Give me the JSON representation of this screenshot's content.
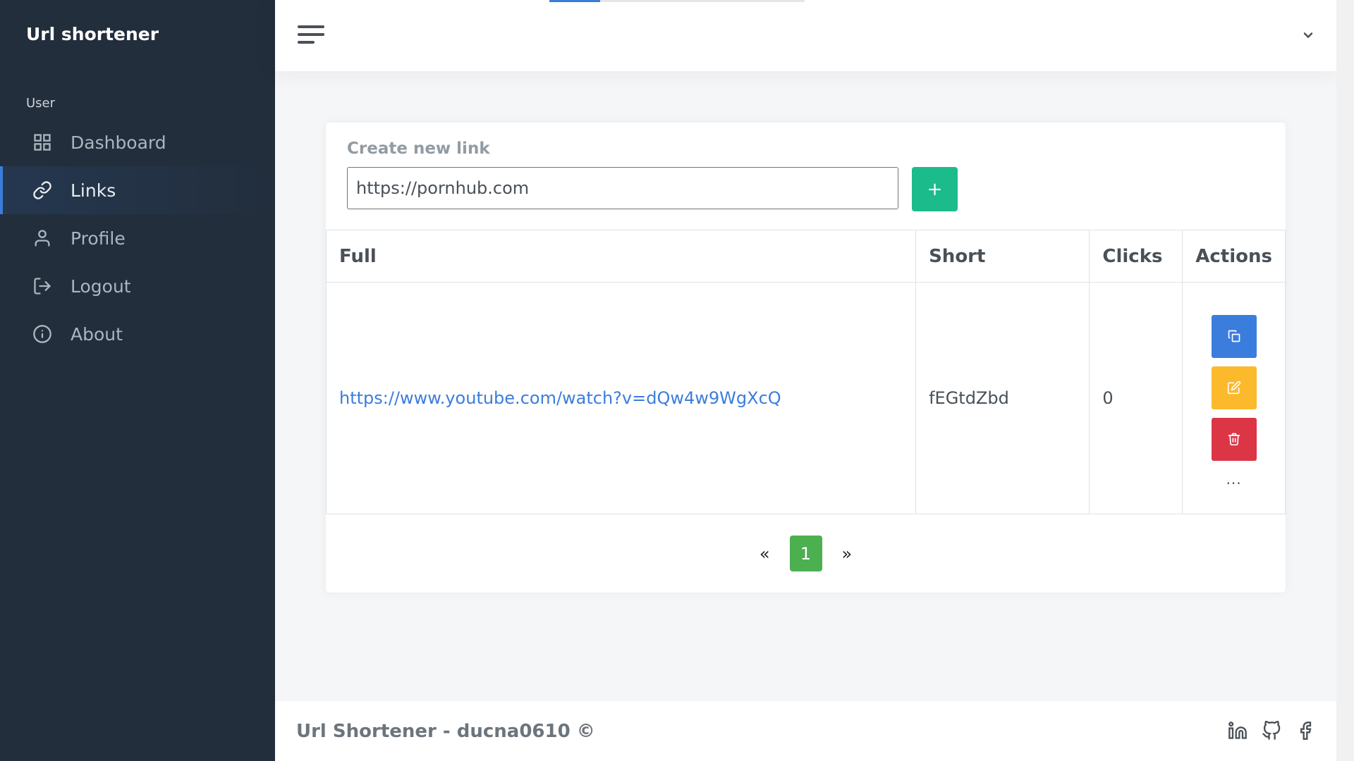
{
  "sidebar": {
    "brand": "Url shortener",
    "section": "User",
    "items": [
      {
        "label": "Dashboard",
        "icon": "grid-icon",
        "active": false
      },
      {
        "label": "Links",
        "icon": "link-icon",
        "active": true
      },
      {
        "label": "Profile",
        "icon": "user-icon",
        "active": false
      },
      {
        "label": "Logout",
        "icon": "logout-icon",
        "active": false
      },
      {
        "label": "About",
        "icon": "info-icon",
        "active": false
      }
    ]
  },
  "topbar": {
    "menu_icon": "hamburger-icon",
    "dropdown_icon": "chevron-down-icon"
  },
  "create": {
    "title": "Create new link",
    "value": "https://pornhub.com",
    "add_label": "+"
  },
  "table": {
    "headers": [
      "Full",
      "Short",
      "Clicks",
      "Actions"
    ],
    "rows": [
      {
        "full": "https://www.youtube.com/watch?v=dQw4w9WgXcQ",
        "short": "fEGtdZbd",
        "clicks": "0"
      }
    ],
    "more_label": "..."
  },
  "pagination": {
    "prev": "«",
    "current": "1",
    "next": "»"
  },
  "footer": {
    "text": "Url Shortener - ducna0610 ©"
  },
  "colors": {
    "sidebar_bg": "#222e3c",
    "primary": "#3b7ddd",
    "success": "#1cbb8c",
    "warning": "#fcb92c",
    "danger": "#dc3545",
    "page_active": "#4caf50"
  }
}
